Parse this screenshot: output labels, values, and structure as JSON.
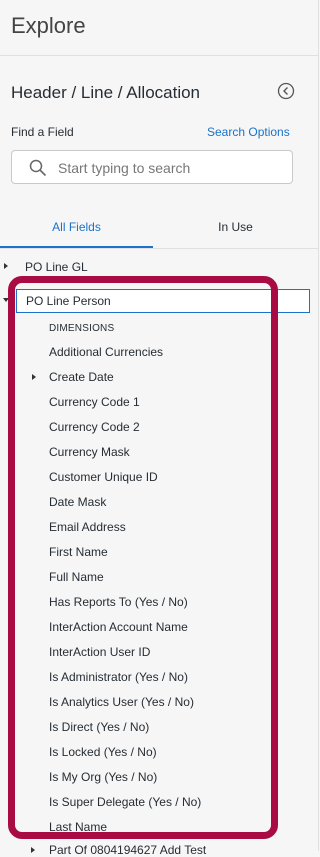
{
  "panel": {
    "title": "Explore",
    "view_name": "Header / Line / Allocation"
  },
  "find": {
    "label": "Find a Field",
    "search_options": "Search Options",
    "placeholder": "Start typing to search"
  },
  "tabs": {
    "all_fields": "All Fields",
    "in_use": "In Use"
  },
  "tree": {
    "collapsed_view": "PO Line GL",
    "expanded_view": "PO Line Person",
    "section": "DIMENSIONS",
    "fields": [
      "Additional Currencies",
      "Create Date",
      "Currency Code 1",
      "Currency Code 2",
      "Currency Mask",
      "Customer Unique ID",
      "Date Mask",
      "Email Address",
      "First Name",
      "Full Name",
      "Has Reports To (Yes / No)",
      "InterAction Account Name",
      "InterAction User ID",
      "Is Administrator (Yes / No)",
      "Is Analytics User (Yes / No)",
      "Is Direct (Yes / No)",
      "Is Locked (Yes / No)",
      "Is My Org (Yes / No)",
      "Is Super Delegate (Yes / No)",
      "Last Name"
    ],
    "next_view": "Part Of 0804194627 Add Test"
  },
  "colors": {
    "accent": "#1a73c8",
    "highlight": "#a80c42"
  },
  "icons": [
    "back-circle-icon",
    "search-icon",
    "caret-right-icon",
    "caret-down-icon"
  ]
}
